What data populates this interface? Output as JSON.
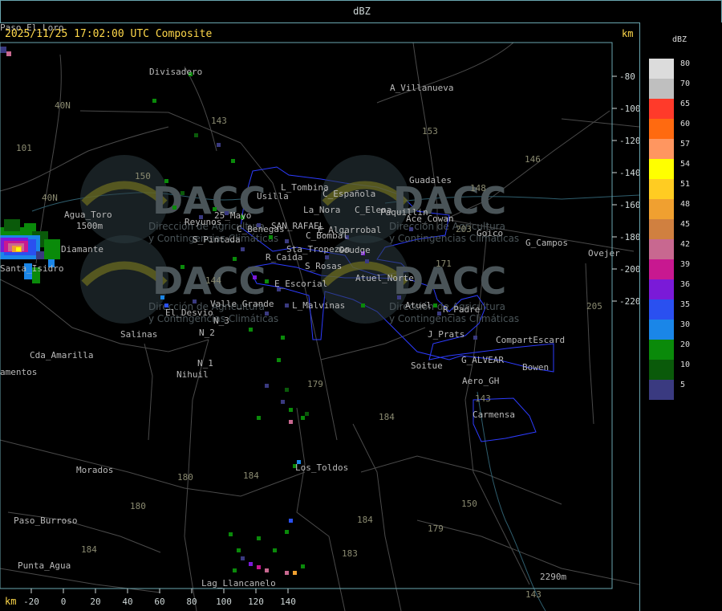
{
  "header": {
    "title": "dBZ"
  },
  "map": {
    "timestamp": "2025/11/25 17:02:00 UTC Composite",
    "km_label_top": "km",
    "km_label_bottom": "km",
    "x_ticks": [
      "-20",
      "0",
      "20",
      "40",
      "60",
      "80",
      "100",
      "120",
      "140"
    ],
    "y_ticks": [
      "-80",
      "-100",
      "-120",
      "-140",
      "-160",
      "-180",
      "-200",
      "-220"
    ],
    "places": [
      "Divisadero",
      "A_Villanueva",
      "40N",
      "101",
      "143",
      "153",
      "146",
      "150",
      "Guadales",
      "148",
      "L_Tombina",
      "Usilla",
      "C_Española",
      "La_Nora",
      "C_Elena",
      "Paquillin",
      "Ace_Cowan",
      "40N",
      "Agua_Toro",
      "1500m",
      "Diamante",
      "Reyunos",
      "25_Mayo",
      "C_Benegas",
      "SAN_RAFAEL",
      "E_Algarrobal",
      "C_Bombal",
      "203",
      "Goico",
      "G_Campos",
      "Ovejer",
      "S_Pintada",
      "Sta_Tropezon",
      "Goudge",
      "Santa_Isidro",
      "R_Caida",
      "S_Rosas",
      "171",
      "Atuel_Norte",
      "144",
      "E_Escorial",
      "Valle_Grande",
      "L_Malvinas",
      "Atuel",
      "R_Padre",
      "205",
      "El_Desvio",
      "N_3",
      "N_2",
      "Salinas",
      "J_Prats",
      "CompartEscard",
      "Cda_Amarilla",
      "N_1",
      "G_ALVEAR",
      "Bowen",
      "amentos",
      "Nihuil",
      "Soitue",
      "Aero_GH",
      "180",
      "179",
      "184",
      "143",
      "Carmensa",
      "Morados",
      "Los_Toldos",
      "184",
      "180",
      "184",
      "179",
      "150",
      "Paso_Burroso",
      "184",
      "183",
      "Punta_Agua",
      "Lag_Llancanelo",
      "2290m",
      "143",
      "Paso_El_Loro"
    ],
    "watermark": {
      "brand": "DACC",
      "line1": "Dirección de Agricultura",
      "line2": "y Contingencias Climáticas"
    }
  },
  "legend": {
    "unit": "dBZ",
    "levels": [
      {
        "value": "80",
        "color": "#dcdcdc"
      },
      {
        "value": "70",
        "color": "#bfbfbf"
      },
      {
        "value": "65",
        "color": "#ff3a2a"
      },
      {
        "value": "60",
        "color": "#ff6a10"
      },
      {
        "value": "57",
        "color": "#ff9660"
      },
      {
        "value": "54",
        "color": "#ffff00"
      },
      {
        "value": "51",
        "color": "#ffcc22"
      },
      {
        "value": "48",
        "color": "#f0a030"
      },
      {
        "value": "45",
        "color": "#d08040"
      },
      {
        "value": "42",
        "color": "#c86890"
      },
      {
        "value": "39",
        "color": "#c81890"
      },
      {
        "value": "36",
        "color": "#7a1ad8"
      },
      {
        "value": "35",
        "color": "#2a50f0"
      },
      {
        "value": "30",
        "color": "#1a86e8"
      },
      {
        "value": "20",
        "color": "#0a8a0a"
      },
      {
        "value": "10",
        "color": "#0a5a0a"
      },
      {
        "value": "5",
        "color": "#3a3a80"
      }
    ]
  }
}
